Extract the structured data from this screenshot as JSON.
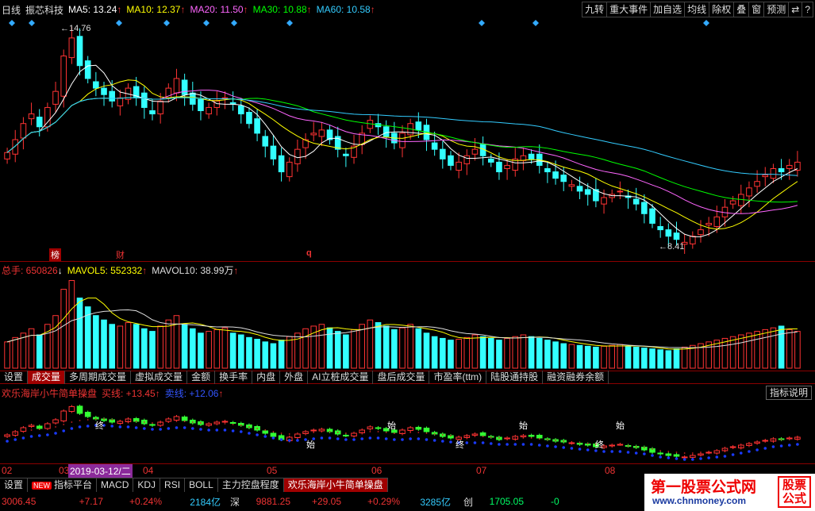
{
  "header": {
    "period": "日线",
    "stock": "振芯科技",
    "ma": [
      {
        "label": "MA5: 13.24",
        "color": "#ffffff"
      },
      {
        "label": "MA10: 12.37",
        "color": "#ffff00"
      },
      {
        "label": "MA20: 11.50",
        "color": "#ff66ff"
      },
      {
        "label": "MA30: 10.88",
        "color": "#00ff00"
      },
      {
        "label": "MA60: 10.58",
        "color": "#33ccff"
      }
    ],
    "arrow": "↑"
  },
  "toolbar": {
    "items": [
      "九转",
      "重大事件",
      "加自选",
      "均线",
      "除权",
      "叠",
      "窗",
      "预测",
      "⇄",
      "?"
    ]
  },
  "price_annotations": {
    "high": "14.76",
    "low": "8.41",
    "marks": [
      "榜",
      "财",
      "q"
    ]
  },
  "volume_header": {
    "total": "总手: 650826",
    "down": "↓",
    "mavol5": "MAVOL5: 552332",
    "mavol10": "MAVOL10: 38.99万",
    "up": "↑"
  },
  "vol_tabs": [
    "设置",
    "成交量",
    "多周期成交量",
    "虚拟成交量",
    "金额",
    "换手率",
    "内盘",
    "外盘",
    "AI立桩成交量",
    "盘后成交量",
    "市盈率(ttm)",
    "陆股通持股",
    "融资融券余额"
  ],
  "vol_tab_active": 1,
  "indicator_header": {
    "name": "欢乐海岸小牛简单操盘",
    "buy": "买线: +13.45",
    "up1": "↑",
    "sell": "卖线: +12.06",
    "up2": "↑",
    "help": "指标说明"
  },
  "indicator_labels": [
    "终",
    "始",
    "始",
    "终",
    "始",
    "终",
    "始"
  ],
  "xaxis": {
    "labels": [
      "02",
      "03",
      "04",
      "05",
      "06",
      "07",
      "08"
    ],
    "cursor_date": "2019-03-12/二"
  },
  "bottom_tabs": {
    "items": [
      "设置",
      "指标平台",
      "MACD",
      "KDJ",
      "RSI",
      "BOLL",
      "主力控盘程度",
      "欢乐海岸小牛简单操盘"
    ],
    "new_badge": "NEW",
    "active_index": 7
  },
  "status": {
    "sh_index": "3006.45",
    "sh_change": "+7.17",
    "sh_pct": "+0.24%",
    "sh_amount": "2184亿",
    "sz_label": "深",
    "sz_index": "9881.25",
    "sz_change": "+29.05",
    "sz_pct": "+0.29%",
    "sz_amount": "3285亿",
    "cy_label": "创",
    "cy_index": "1705.05",
    "cy_trunc": "-0"
  },
  "watermark": {
    "title": "第一股票公式网",
    "url": "www.chnmoney.com",
    "badge": "股票公式"
  },
  "chart_data": {
    "type": "candlestick",
    "price_range": [
      8.41,
      14.76
    ],
    "closes": [
      11.2,
      11.6,
      12.1,
      12.4,
      12.0,
      12.6,
      13.1,
      14.2,
      14.76,
      13.9,
      13.5,
      13.2,
      13.0,
      12.8,
      12.9,
      13.2,
      12.9,
      12.6,
      12.4,
      12.8,
      13.2,
      13.5,
      13.0,
      12.7,
      12.5,
      12.6,
      12.8,
      12.9,
      12.7,
      12.4,
      12.1,
      11.8,
      11.4,
      11.0,
      10.6,
      10.9,
      11.3,
      11.6,
      11.8,
      11.9,
      11.6,
      11.3,
      11.1,
      11.4,
      11.8,
      12.2,
      12.0,
      11.7,
      11.5,
      11.8,
      12.1,
      11.9,
      11.6,
      11.3,
      11.0,
      10.8,
      10.9,
      11.1,
      11.3,
      11.1,
      10.9,
      10.6,
      10.8,
      11.0,
      11.1,
      11.0,
      10.8,
      10.6,
      10.4,
      10.3,
      10.2,
      10.0,
      9.9,
      9.7,
      9.8,
      9.9,
      10.0,
      9.8,
      9.6,
      9.3,
      9.0,
      8.8,
      8.6,
      8.5,
      8.41,
      8.6,
      8.8,
      9.0,
      9.2,
      9.5,
      9.7,
      9.9,
      10.1,
      10.3,
      10.5,
      10.7,
      10.6,
      10.8,
      10.9
    ],
    "volumes": [
      30,
      35,
      40,
      45,
      38,
      50,
      60,
      90,
      100,
      80,
      70,
      60,
      55,
      50,
      48,
      52,
      50,
      45,
      42,
      48,
      55,
      60,
      50,
      45,
      40,
      42,
      44,
      46,
      40,
      38,
      35,
      33,
      30,
      28,
      32,
      36,
      40,
      45,
      48,
      50,
      46,
      42,
      38,
      44,
      50,
      55,
      52,
      48,
      44,
      46,
      50,
      45,
      40,
      36,
      34,
      32,
      33,
      35,
      38,
      36,
      34,
      32,
      34,
      36,
      38,
      36,
      34,
      32,
      30,
      28,
      27,
      26,
      25,
      24,
      25,
      26,
      27,
      25,
      24,
      23,
      22,
      21,
      20,
      22,
      24,
      26,
      28,
      30,
      32,
      34,
      36,
      38,
      40,
      42,
      44,
      46,
      48,
      44,
      42
    ],
    "buy_line": [
      11.0,
      11.2,
      11.4,
      11.6,
      11.7,
      11.8,
      12.0,
      12.3,
      12.6,
      12.8,
      12.9,
      13.0,
      13.0,
      12.9,
      12.8,
      12.8,
      12.7,
      12.6,
      12.5,
      12.5,
      12.6,
      12.7,
      12.7,
      12.6,
      12.5,
      12.4,
      12.4,
      12.4,
      12.3,
      12.2,
      12.0,
      11.8,
      11.6,
      11.4,
      11.2,
      11.1,
      11.1,
      11.2,
      11.3,
      11.4,
      11.4,
      11.3,
      11.2,
      11.2,
      11.3,
      11.4,
      11.4,
      11.3,
      11.2,
      11.2,
      11.3,
      11.3,
      11.2,
      11.1,
      11.0,
      10.9,
      10.8,
      10.8,
      10.8,
      10.8,
      10.7,
      10.6,
      10.6,
      10.6,
      10.6,
      10.6,
      10.5,
      10.4,
      10.3,
      10.2,
      10.1,
      10.0,
      9.9,
      9.8,
      9.7,
      9.7,
      9.7,
      9.6,
      9.5,
      9.4,
      9.2,
      9.0,
      8.9,
      8.8,
      8.7,
      8.7,
      8.8,
      8.9,
      9.0,
      9.1,
      9.3,
      9.5,
      9.7,
      9.9,
      10.1,
      10.3,
      10.4,
      10.5,
      10.6
    ]
  }
}
